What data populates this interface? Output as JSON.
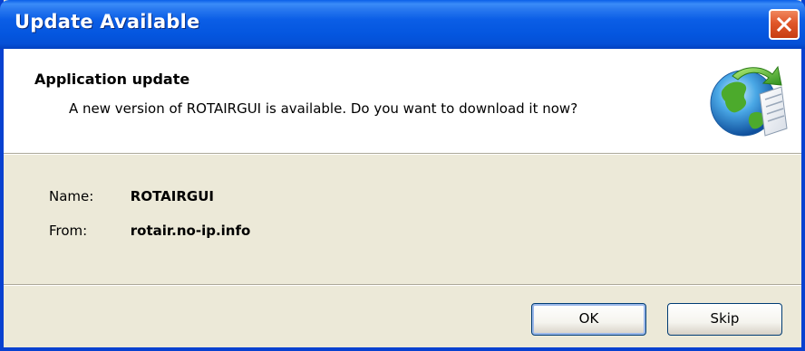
{
  "window": {
    "title": "Update Available"
  },
  "header": {
    "title": "Application update",
    "description": "A new version of ROTAIRGUI is available. Do you want to download it now?",
    "icon": "globe-update-icon"
  },
  "details": {
    "name_label": "Name:",
    "name_value": "ROTAIRGUI",
    "from_label": "From:",
    "from_value": "rotair.no-ip.info"
  },
  "buttons": {
    "ok_label": "OK",
    "skip_label": "Skip"
  },
  "colors": {
    "titlebar": "#0456df",
    "close_button": "#e0572a",
    "dialog_background": "#ece9d8",
    "header_background": "#ffffff"
  }
}
